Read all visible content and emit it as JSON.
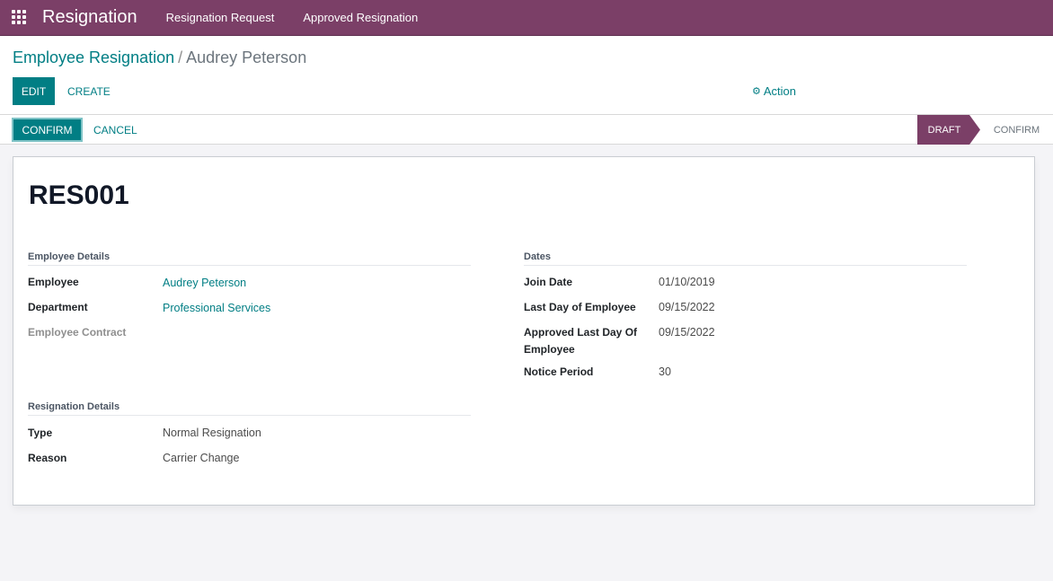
{
  "app": {
    "title": "Resignation",
    "menu": [
      "Resignation Request",
      "Approved Resignation"
    ]
  },
  "breadcrumb": {
    "parent": "Employee Resignation",
    "separator": "/",
    "current": "Audrey Peterson"
  },
  "toolbar": {
    "edit_label": "EDIT",
    "create_label": "CREATE",
    "action_label": "Action",
    "action_icon": "gear-icon"
  },
  "statusbar": {
    "confirm_label": "CONFIRM",
    "cancel_label": "CANCEL",
    "stages": [
      {
        "label": "DRAFT",
        "active": true
      },
      {
        "label": "CONFIRM",
        "active": false
      }
    ]
  },
  "record": {
    "name": "RES001",
    "employee_details": {
      "title": "Employee Details",
      "employee_label": "Employee",
      "employee_value": "Audrey Peterson",
      "department_label": "Department",
      "department_value": "Professional Services",
      "contract_label": "Employee Contract"
    },
    "resignation_details": {
      "title": "Resignation Details",
      "type_label": "Type",
      "type_value": "Normal Resignation",
      "reason_label": "Reason",
      "reason_value": "Carrier Change"
    },
    "dates": {
      "title": "Dates",
      "join_date_label": "Join Date",
      "join_date_value": "01/10/2019",
      "last_day_label": "Last Day of Employee",
      "last_day_value": "09/15/2022",
      "approved_last_day_label_line1": "Approved Last Day Of",
      "approved_last_day_label_line2": "Employee",
      "approved_last_day_value": "09/15/2022",
      "notice_period_label": "Notice Period",
      "notice_period_value": "30"
    }
  },
  "colors": {
    "brand": "#7b3f67",
    "primary": "#017e84"
  }
}
